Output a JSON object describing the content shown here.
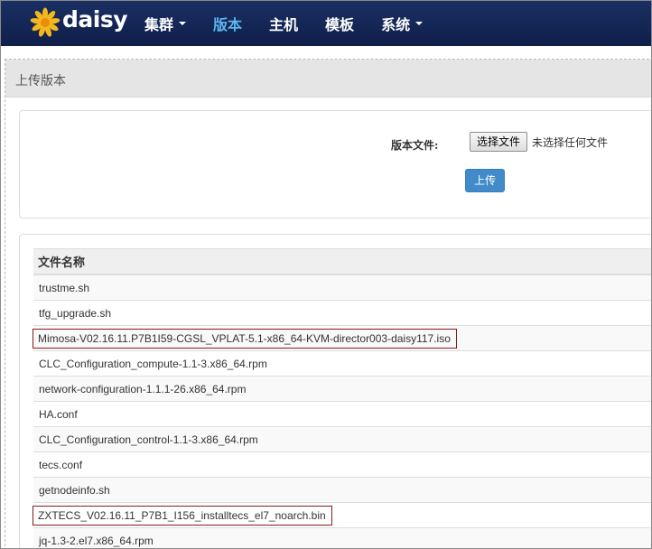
{
  "navbar": {
    "logo_text": "daisy",
    "items": [
      {
        "label": "集群",
        "dropdown": true,
        "active": false
      },
      {
        "label": "版本",
        "dropdown": false,
        "active": true
      },
      {
        "label": "主机",
        "dropdown": false,
        "active": false
      },
      {
        "label": "模板",
        "dropdown": false,
        "active": false
      },
      {
        "label": "系统",
        "dropdown": true,
        "active": false
      }
    ]
  },
  "page": {
    "title": "上传版本"
  },
  "upload": {
    "field_label": "版本文件:",
    "file_button_label": "选择文件",
    "file_status": "未选择任何文件",
    "upload_button_label": "上传"
  },
  "file_table": {
    "header": "文件名称",
    "rows": [
      {
        "name": "trustme.sh",
        "highlighted": false
      },
      {
        "name": "tfg_upgrade.sh",
        "highlighted": false
      },
      {
        "name": "Mimosa-V02.16.11.P7B1I59-CGSL_VPLAT-5.1-x86_64-KVM-director003-daisy117.iso",
        "highlighted": true
      },
      {
        "name": "CLC_Configuration_compute-1.1-3.x86_64.rpm",
        "highlighted": false
      },
      {
        "name": "network-configuration-1.1.1-26.x86_64.rpm",
        "highlighted": false
      },
      {
        "name": "HA.conf",
        "highlighted": false
      },
      {
        "name": "CLC_Configuration_control-1.1-3.x86_64.rpm",
        "highlighted": false
      },
      {
        "name": "tecs.conf",
        "highlighted": false
      },
      {
        "name": "getnodeinfo.sh",
        "highlighted": false
      },
      {
        "name": "ZXTECS_V02.16.11_P7B1_I156_installtecs_el7_noarch.bin",
        "highlighted": true
      },
      {
        "name": "jq-1.3-2.el7.x86_64.rpm",
        "highlighted": false
      }
    ]
  },
  "colors": {
    "navbar_bg": "#13265a",
    "active_nav": "#5bb7ee",
    "primary_button": "#428bca",
    "highlight_border": "#8b1a1a"
  }
}
